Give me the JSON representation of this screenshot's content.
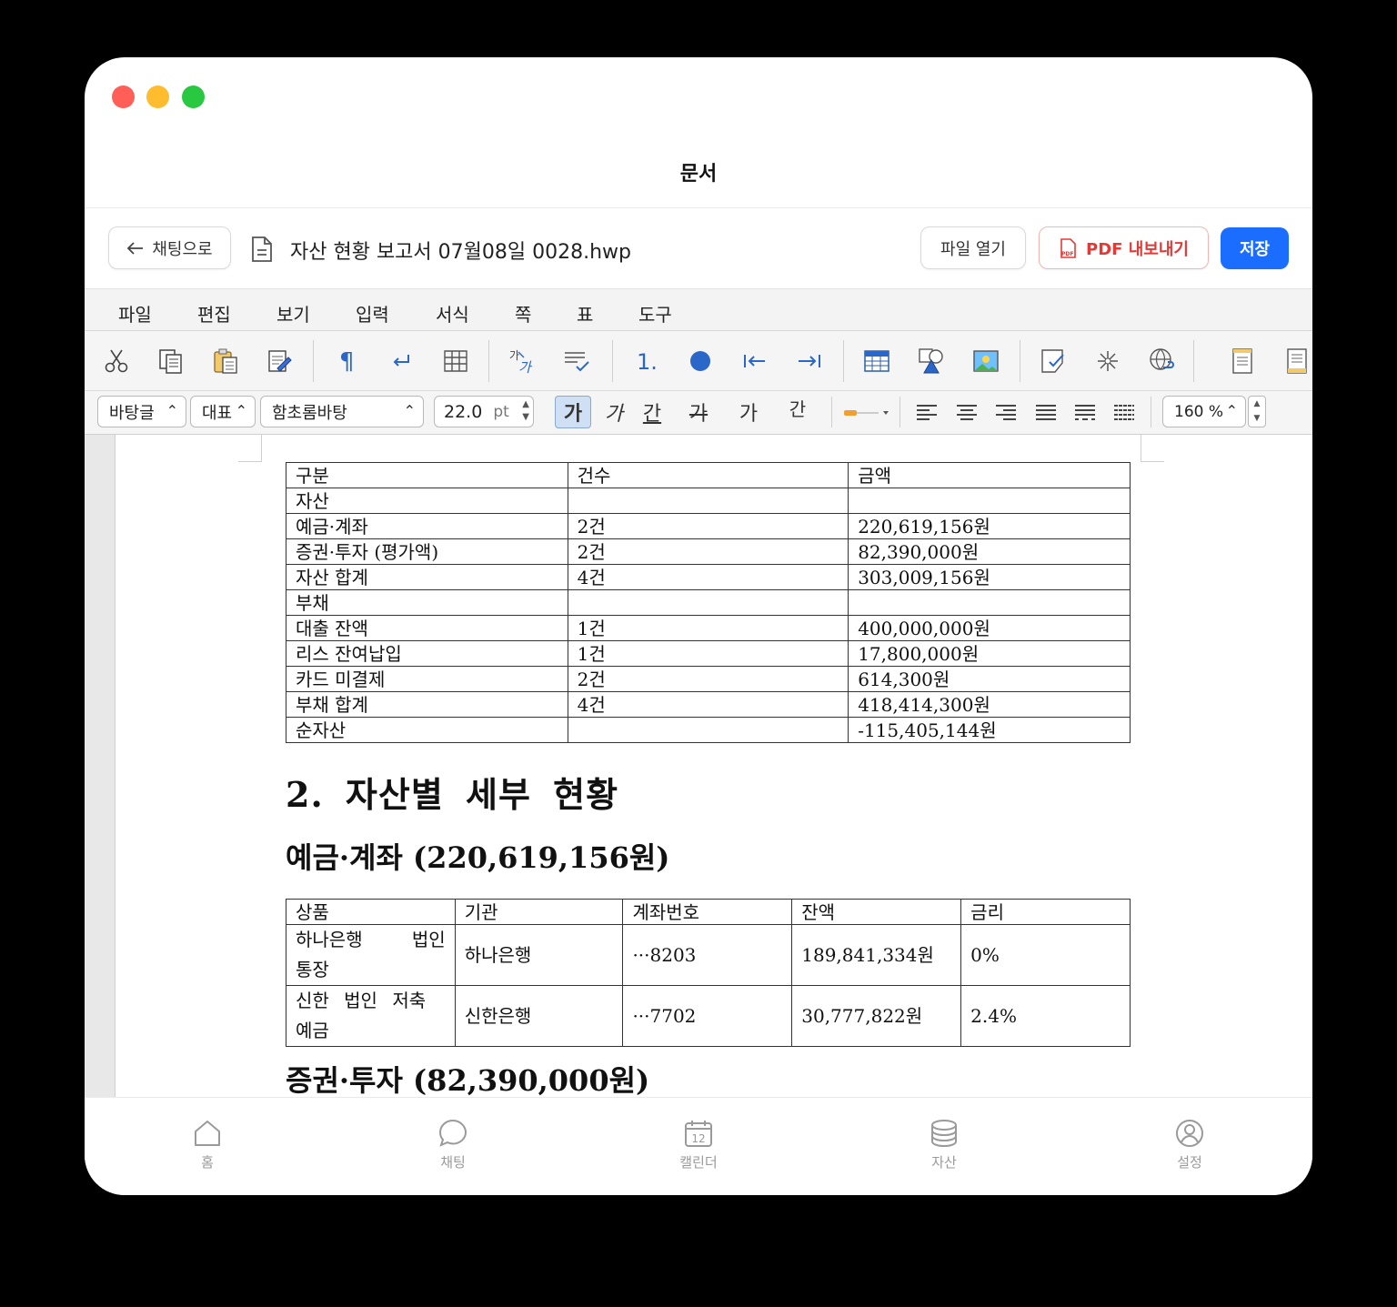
{
  "window": {
    "title": "문서"
  },
  "header": {
    "back_label": "채팅으로",
    "file_name": "자산 현황 보고서 07월08일 0028.hwp",
    "open_label": "파일 열기",
    "pdf_label": "PDF 내보내기",
    "save_label": "저장"
  },
  "menu": [
    "파일",
    "편집",
    "보기",
    "입력",
    "서식",
    "쪽",
    "표",
    "도구"
  ],
  "toolbar": {
    "style_select": "바탕글",
    "lang_select": "대표",
    "font_select": "함초롬바탕",
    "font_size": "22.0",
    "font_unit": "pt",
    "bold_label": "가",
    "italic_label": "가",
    "underline_label": "간",
    "strike_label": "가",
    "super_label": "가",
    "char_label": "간",
    "line_spacing": "160 %"
  },
  "summary_table": {
    "headers": [
      "구분",
      "건수",
      "금액"
    ],
    "rows": [
      [
        "자산",
        "",
        ""
      ],
      [
        "예금·계좌",
        "2건",
        "220,619,156원"
      ],
      [
        "증권·투자 (평가액)",
        "2건",
        "82,390,000원"
      ],
      [
        "자산 합계",
        "4건",
        "303,009,156원"
      ],
      [
        "부채",
        "",
        ""
      ],
      [
        "대출 잔액",
        "1건",
        "400,000,000원"
      ],
      [
        "리스 잔여납입",
        "1건",
        "17,800,000원"
      ],
      [
        "카드 미결제",
        "2건",
        "614,300원"
      ],
      [
        "부채 합계",
        "4건",
        "418,414,300원"
      ],
      [
        "순자산",
        "",
        "-115,405,144원"
      ]
    ]
  },
  "section2_title": "2. 자산별 세부 현황",
  "deposit_title": "예금·계좌 (220,619,156원)",
  "deposit_table": {
    "headers": [
      "상품",
      "기관",
      "계좌번호",
      "잔액",
      "금리"
    ],
    "rows": [
      [
        "하나은행 법인 통장",
        "하나은행",
        "···8203",
        "189,841,334원",
        "0%"
      ],
      [
        "신한 법인 저축 예금",
        "신한은행",
        "···7702",
        "30,777,822원",
        "2.4%"
      ]
    ]
  },
  "securities_title": "증권·투자 (82,390,000원)",
  "nav": {
    "home": "홈",
    "chat": "채팅",
    "calendar": "캘린더",
    "calendar_day": "12",
    "assets": "자산",
    "settings": "설정"
  },
  "colors": {
    "accent": "#1a6dff",
    "pdf": "#e53935"
  }
}
